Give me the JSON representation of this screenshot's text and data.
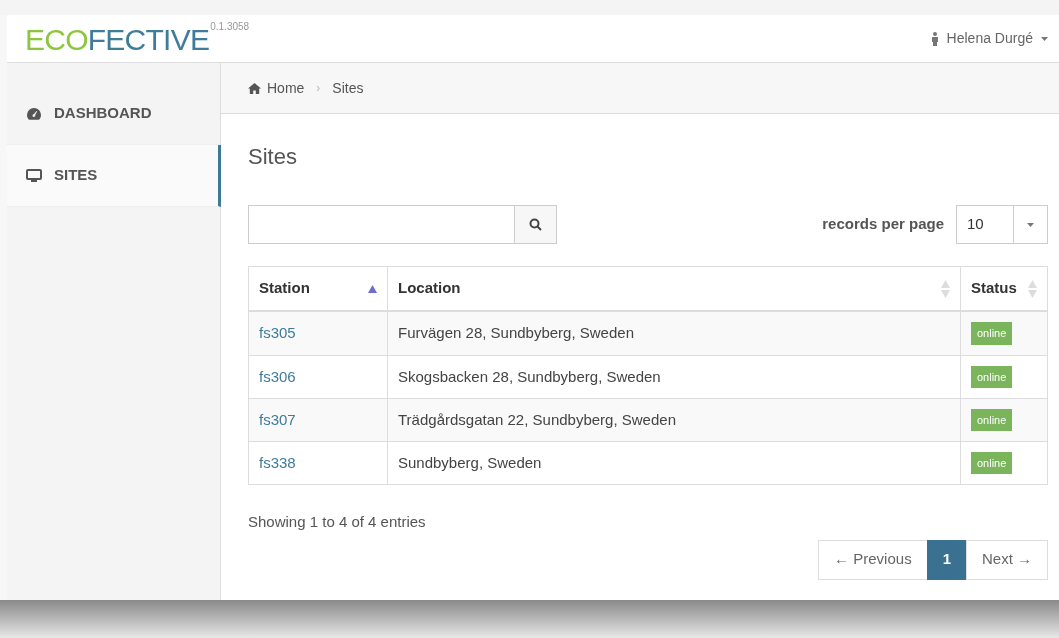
{
  "header": {
    "logo": [
      "ECO",
      "FECTIVE"
    ],
    "version": "0.1.3058",
    "user": "Helena Durgé"
  },
  "sidebar": {
    "items": [
      {
        "label": "DASHBOARD",
        "kind": "dashboard",
        "selected": false
      },
      {
        "label": "SITES",
        "kind": "monitor",
        "selected": true
      }
    ]
  },
  "breadcrumb": {
    "separator": "›",
    "items": [
      {
        "label": "Home",
        "kind": "home"
      },
      {
        "label": "Sites",
        "kind": "plain"
      }
    ]
  },
  "page_title": "Sites",
  "records_per_page": {
    "label": "records per page",
    "value": "10"
  },
  "table": {
    "columns": [
      {
        "label": "Station",
        "sorted": true
      },
      {
        "label": "Location",
        "sorted": false
      },
      {
        "label": "Status",
        "sorted": false
      }
    ],
    "rows": [
      {
        "station": "fs305",
        "location": "Furvägen 28, Sundbyberg, Sweden",
        "status": "online",
        "color": "#7ab55c"
      },
      {
        "station": "fs306",
        "location": "Skogsbacken 28, Sundbyberg, Sweden",
        "status": "online",
        "color": "#7ab55c"
      },
      {
        "station": "fs307",
        "location": "Trädgårdsgatan 22, Sundbyberg, Sweden",
        "status": "online",
        "color": "#7ab55c"
      },
      {
        "station": "fs338",
        "location": "Sundbyberg, Sweden",
        "status": "online",
        "color": "#7ab55c"
      }
    ]
  },
  "info": "Showing 1 to 4 of 4 entries",
  "pagination": [
    {
      "label": "← Previous",
      "selected": false
    },
    {
      "label": "1",
      "selected": true
    },
    {
      "label": "Next →",
      "selected": false
    }
  ]
}
